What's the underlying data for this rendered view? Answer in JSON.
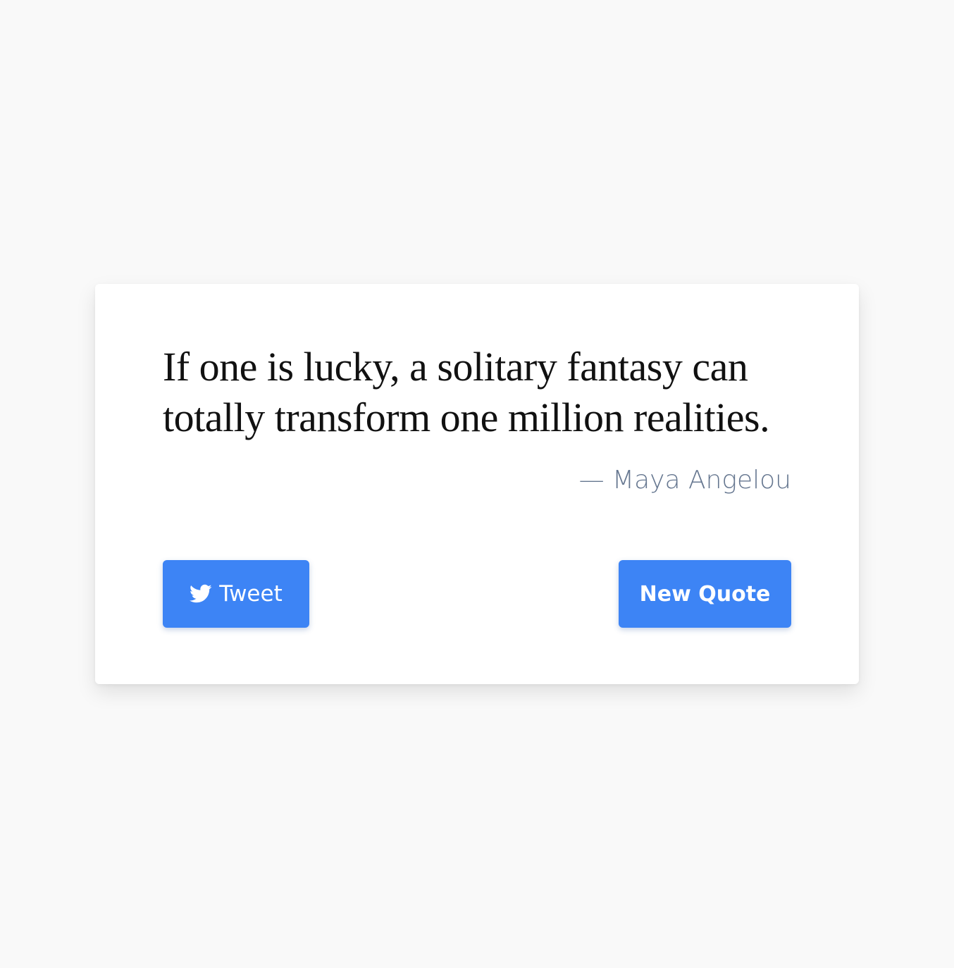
{
  "quote": {
    "text": "If one is lucky, a solitary fantasy can totally transform one million realities.",
    "author": "— Maya Angelou"
  },
  "buttons": {
    "tweet_label": "Tweet",
    "tweet_icon": "twitter-bird-icon",
    "new_quote_label": "New Quote"
  },
  "colors": {
    "background": "#f9f9f9",
    "card": "#ffffff",
    "accent": "#3d84f5",
    "author_text": "#667790"
  }
}
